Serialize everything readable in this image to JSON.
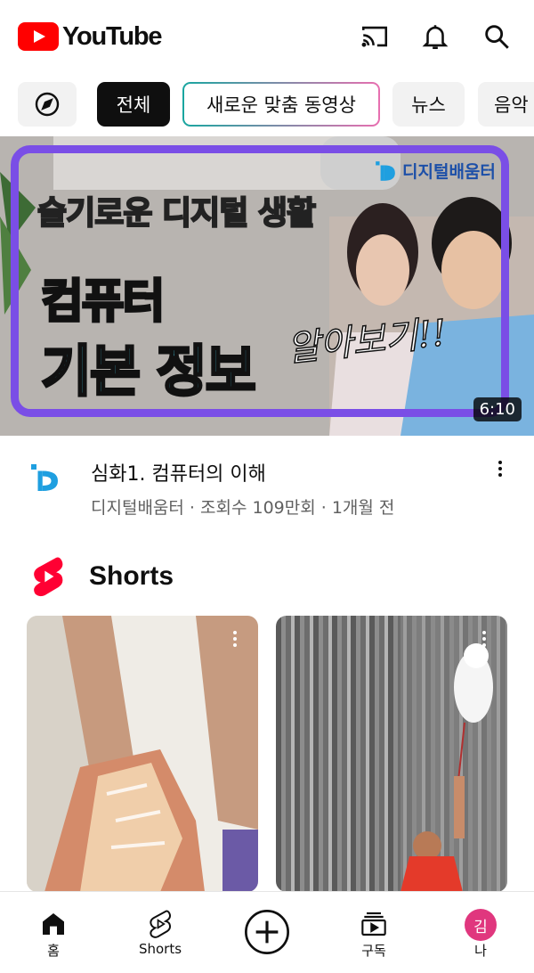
{
  "header": {
    "logo_text": "YouTube",
    "icons": [
      "cast-icon",
      "bell-icon",
      "search-icon"
    ]
  },
  "chips": {
    "explore_icon": "compass-icon",
    "items": [
      "전체",
      "새로운 맞춤 동영상",
      "뉴스",
      "음악"
    ],
    "selected": "전체"
  },
  "video": {
    "thumbnail": {
      "brand": "디지털배움터",
      "line1": "슬기로운 디지털 생활",
      "line2": "컴퓨터",
      "line3": "기본 정보",
      "script": "알아보기!!"
    },
    "duration": "6:10",
    "title": "심화1. 컴퓨터의 이해",
    "meta": "디지털배움터 · 조회수 109만회 · 1개월 전"
  },
  "shorts": {
    "title": "Shorts"
  },
  "bottom_nav": {
    "items": [
      "홈",
      "Shorts",
      "",
      "구독",
      "나"
    ],
    "avatar_text": "김"
  },
  "colors": {
    "brand_red": "#ff0000",
    "thumbnail_frame": "#7a4ee6",
    "avatar": "#e0377e",
    "channel_icon": "#1f9fe0"
  }
}
